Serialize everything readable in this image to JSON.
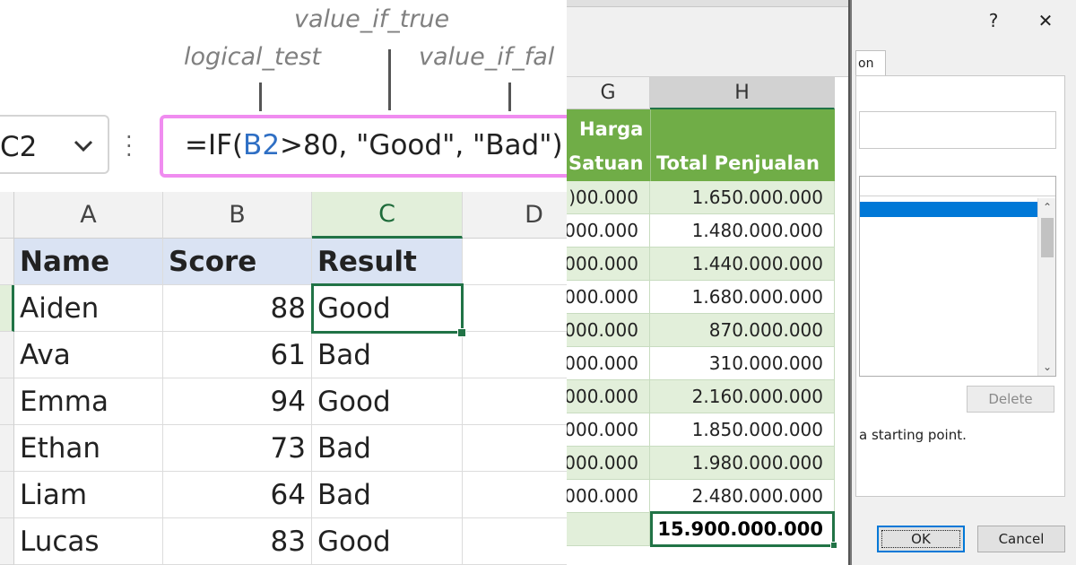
{
  "annotations": {
    "value_if_true": "value_if_true",
    "logical_test": "logical_test",
    "value_if_false": "value_if_fal"
  },
  "name_box": {
    "value": "C2",
    "chevron_icon": "chevron-down-icon"
  },
  "formula_bar": {
    "more_icon": "vertical-dots-icon",
    "prefix": "=IF(",
    "ref": "B2",
    "suffix": ">80, \"Good\", \"Bad\")",
    "ref_color": "#2f6fc4",
    "border_color": "#f08cf0"
  },
  "sheet1": {
    "columns": [
      "A",
      "B",
      "C",
      "D"
    ],
    "headers": [
      "Name",
      "Score",
      "Result"
    ],
    "rows": [
      [
        "Aiden",
        "88",
        "Good"
      ],
      [
        "Ava",
        "61",
        "Bad"
      ],
      [
        "Emma",
        "94",
        "Good"
      ],
      [
        "Ethan",
        "73",
        "Bad"
      ],
      [
        "Liam",
        "64",
        "Bad"
      ],
      [
        "Lucas",
        "83",
        "Good"
      ]
    ],
    "active_cell": "C2"
  },
  "sheet2": {
    "columns": [
      "G",
      "H"
    ],
    "header_g": [
      "Harga",
      "Satuan"
    ],
    "header_h": "Total Penjualan",
    "header_color": "#70ad47",
    "rows": [
      [
        ")00.000",
        "1.650.000.000"
      ],
      [
        "000.000",
        "1.480.000.000"
      ],
      [
        "000.000",
        "1.440.000.000"
      ],
      [
        "000.000",
        "1.680.000.000"
      ],
      [
        "000.000",
        "870.000.000"
      ],
      [
        "000.000",
        "310.000.000"
      ],
      [
        "000.000",
        "2.160.000.000"
      ],
      [
        "000.000",
        "1.850.000.000"
      ],
      [
        "000.000",
        "1.980.000.000"
      ],
      [
        "000.000",
        "2.480.000.000"
      ]
    ],
    "total": "15.900.000.000"
  },
  "dialog": {
    "help_label": "?",
    "close_label": "✕",
    "tab_label": "on",
    "delete_label": "Delete",
    "hint": "a starting point.",
    "ok_label": "OK",
    "cancel_label": "Cancel",
    "scroll_up": "⌃",
    "scroll_down": "⌄",
    "selection_color": "#0078d7"
  }
}
